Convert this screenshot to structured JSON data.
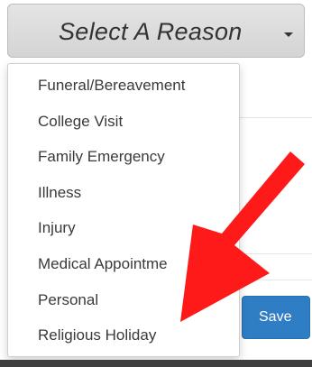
{
  "select": {
    "label": "Select A Reason"
  },
  "dropdown": {
    "items": [
      {
        "label": "Funeral/Bereavement"
      },
      {
        "label": "College Visit"
      },
      {
        "label": "Family Emergency"
      },
      {
        "label": "Illness"
      },
      {
        "label": "Injury"
      },
      {
        "label": "Medical Appointme"
      },
      {
        "label": "Personal"
      },
      {
        "label": "Religious Holiday"
      }
    ]
  },
  "form": {
    "save_label": "Save"
  },
  "icons": {
    "caret": "chevron-down-icon",
    "annotation": "red-arrow-icon"
  },
  "colors": {
    "arrow": "#ff1a1a",
    "save_button": "#2f7dc4"
  }
}
